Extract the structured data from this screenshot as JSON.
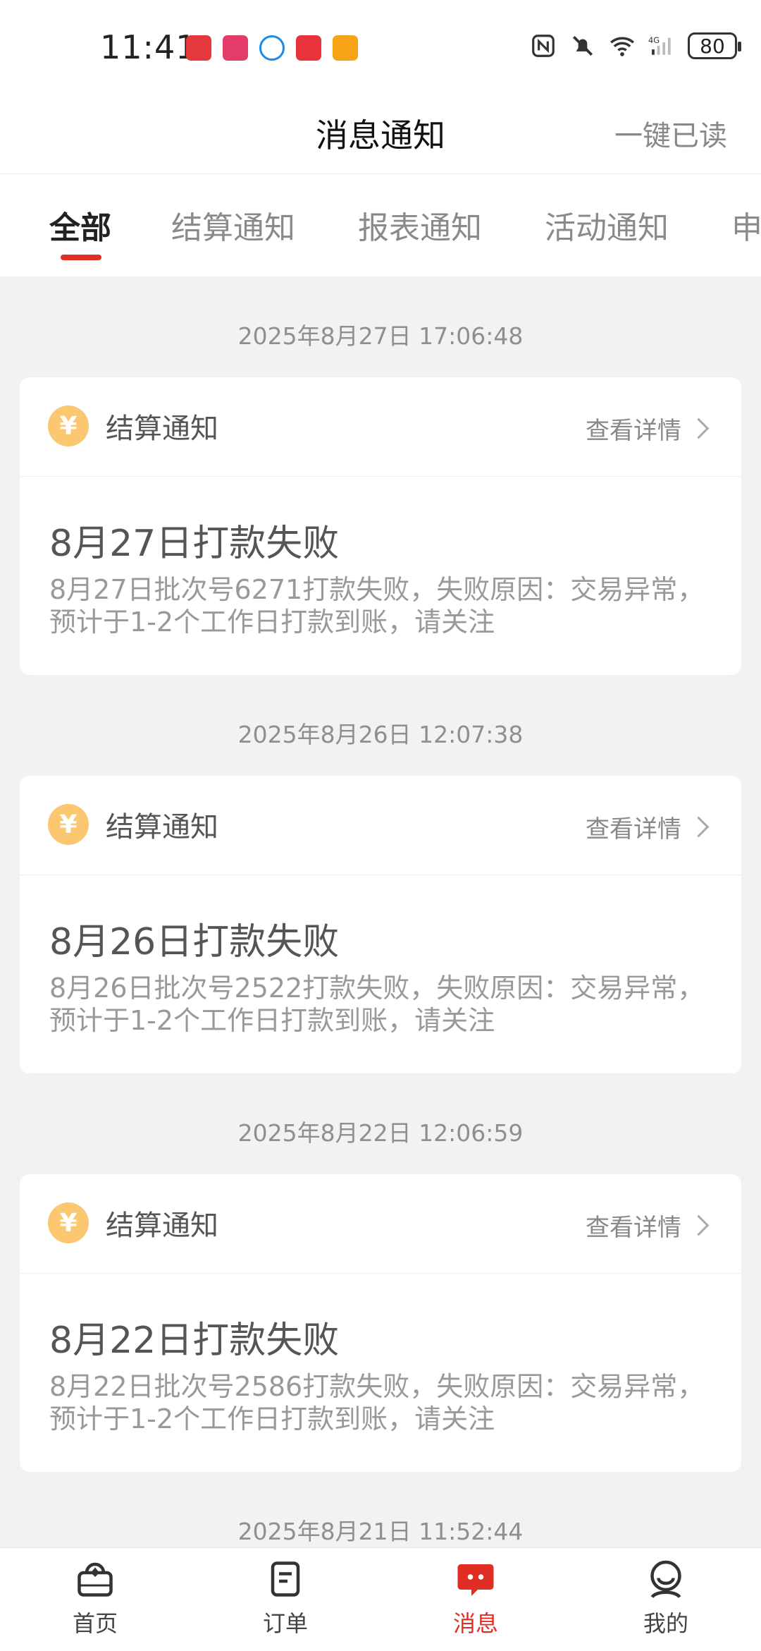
{
  "status_bar": {
    "time": "11:41",
    "battery": "80",
    "icons": [
      "jd-app-icon",
      "huawei-app-icon",
      "chat-app-icon",
      "red-app-icon",
      "video-app-icon",
      "nfc-icon",
      "mute-icon",
      "wifi-icon",
      "signal-4g-icon"
    ]
  },
  "header": {
    "title": "消息通知",
    "mark_all_read": "一键已读"
  },
  "tabs": [
    {
      "label": "全部",
      "active": true
    },
    {
      "label": "结算通知",
      "active": false
    },
    {
      "label": "报表通知",
      "active": false
    },
    {
      "label": "活动通知",
      "active": false
    },
    {
      "label": "申",
      "active": false
    }
  ],
  "messages": [
    {
      "timestamp": "2025年8月27日 17:06:48",
      "type": "结算通知",
      "detail_label": "查看详情",
      "title": "8月27日打款失败",
      "text": "8月27日批次号6271打款失败，失败原因：交易异常，预计于1-2个工作日打款到账，请关注"
    },
    {
      "timestamp": "2025年8月26日 12:07:38",
      "type": "结算通知",
      "detail_label": "查看详情",
      "title": "8月26日打款失败",
      "text": "8月26日批次号2522打款失败，失败原因：交易异常，预计于1-2个工作日打款到账，请关注"
    },
    {
      "timestamp": "2025年8月22日 12:06:59",
      "type": "结算通知",
      "detail_label": "查看详情",
      "title": "8月22日打款失败",
      "text": "8月22日批次号2586打款失败，失败原因：交易异常，预计于1-2个工作日打款到账，请关注"
    },
    {
      "timestamp": "2025年8月21日 11:52:44"
    }
  ],
  "bottom_nav": [
    {
      "label": "首页",
      "icon": "home-icon"
    },
    {
      "label": "订单",
      "icon": "order-icon"
    },
    {
      "label": "消息",
      "icon": "message-icon",
      "active": true
    },
    {
      "label": "我的",
      "icon": "profile-icon"
    }
  ],
  "colors": {
    "accent": "#e02e24",
    "yen_badge": "#fbc770",
    "background": "#f2f2f2"
  },
  "currency_symbol": "¥"
}
